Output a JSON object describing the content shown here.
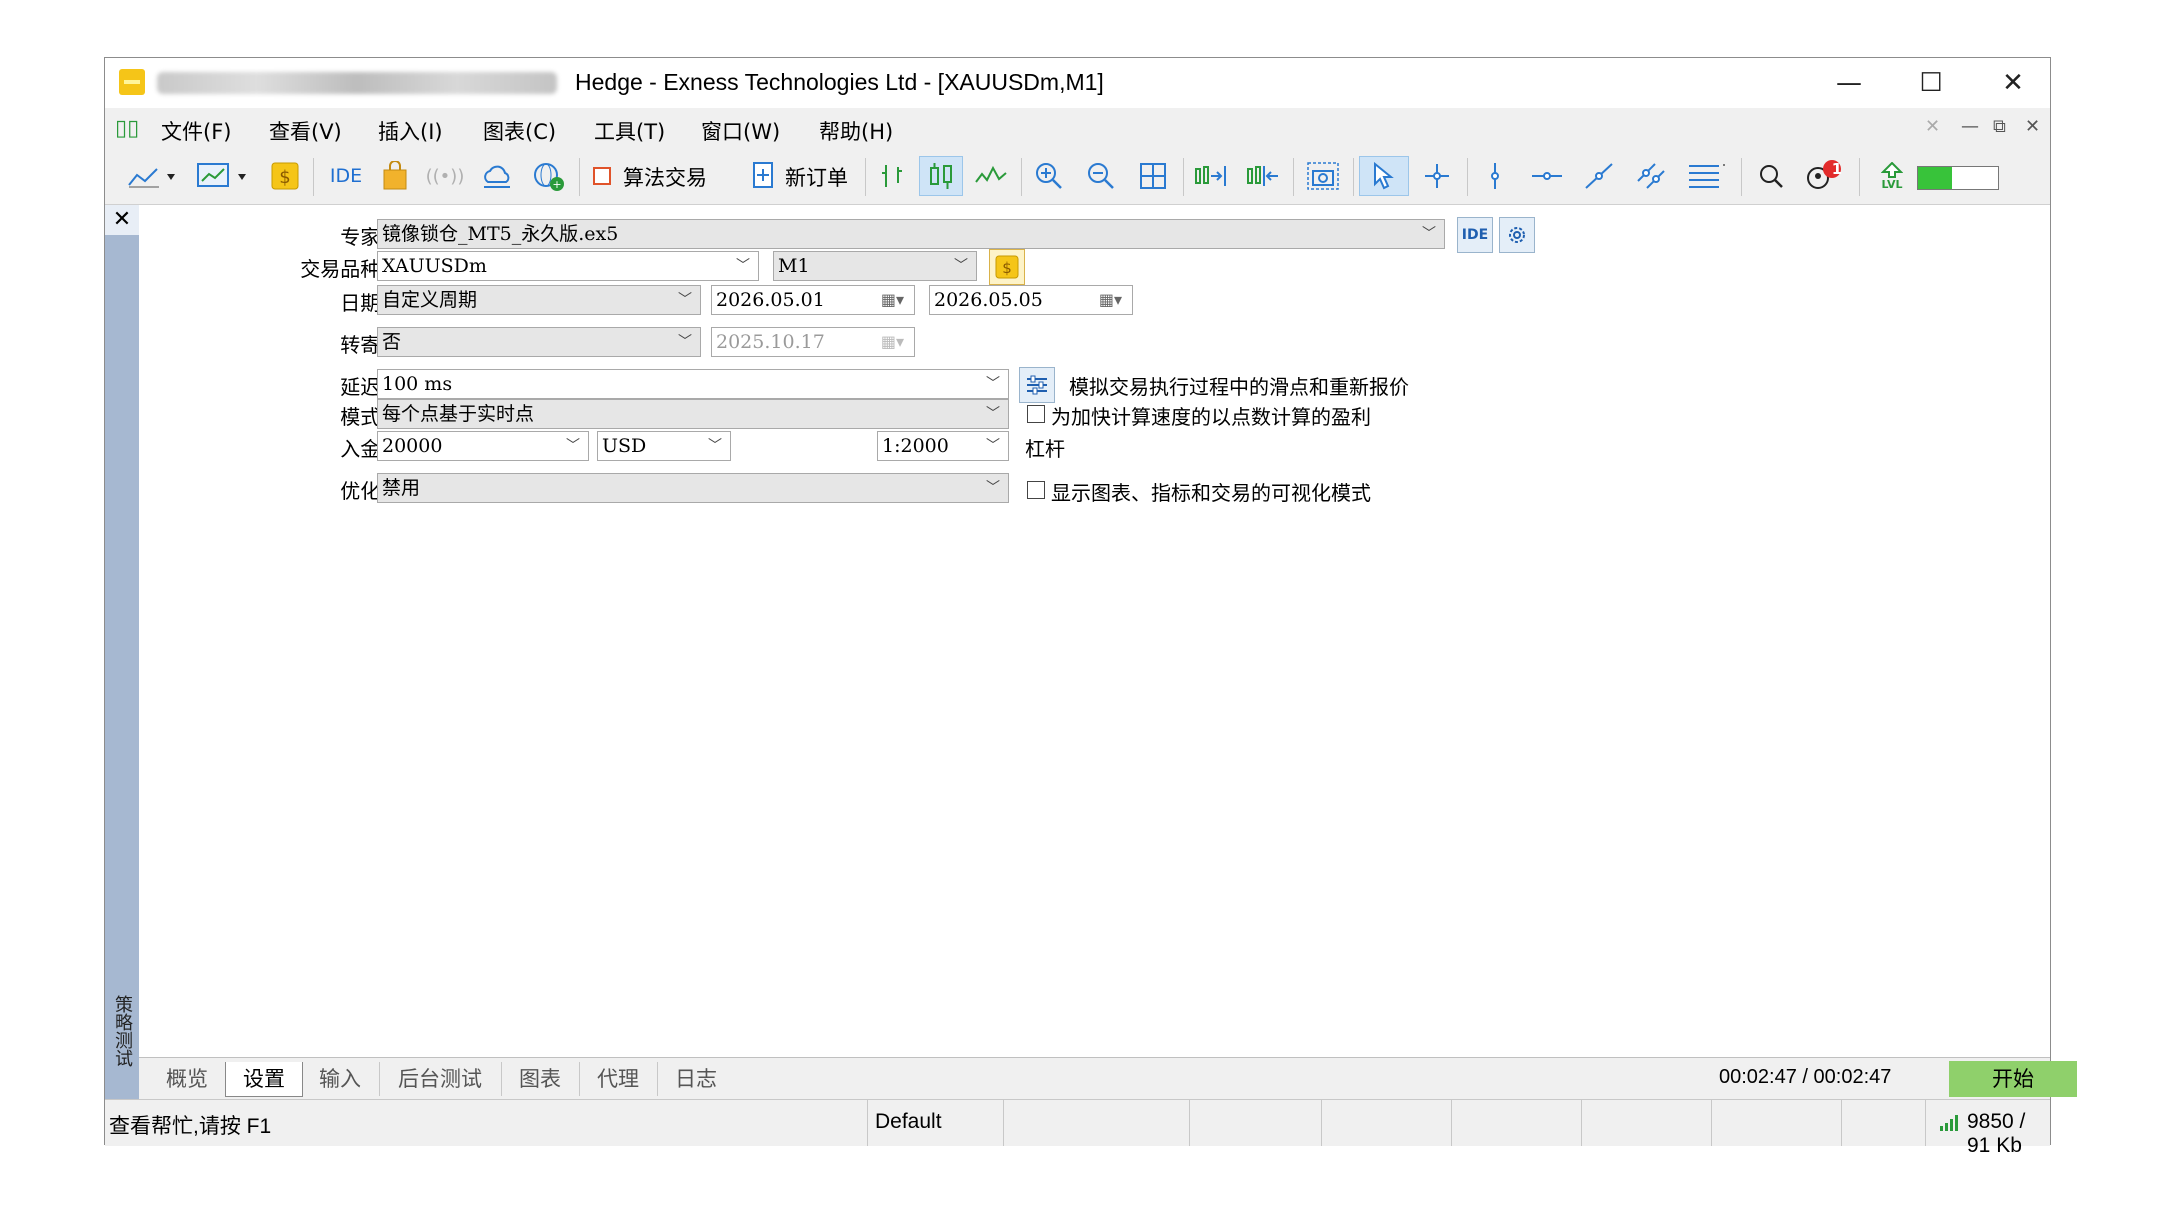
{
  "window": {
    "title": "Hedge - Exness Technologies Ltd - [XAUUSDm,M1]",
    "minimize_glyph": "—",
    "maximize_glyph": "☐",
    "close_glyph": "✕"
  },
  "menu": {
    "items": [
      "文件(F)",
      "查看(V)",
      "插入(I)",
      "图表(C)",
      "工具(T)",
      "窗口(W)",
      "帮助(H)"
    ],
    "doc_controls": [
      "✕",
      "—",
      "⧉",
      "✕"
    ]
  },
  "toolbar": {
    "ide_label": "IDE",
    "algo_trading_label": "算法交易",
    "new_order_label": "新订单",
    "notification_count": "1",
    "level_label": "LVL"
  },
  "sidebar": {
    "close_glyph": "✕",
    "vertical_label": "策略测试"
  },
  "form": {
    "expert_label": "专家:",
    "expert_value": "镜像锁仓_MT5_永久版.ex5",
    "ide_button": "IDE",
    "symbol_label": "交易品种:",
    "symbol_value": "XAUUSDm",
    "timeframe_value": "M1",
    "date_label": "日期:",
    "date_mode_value": "自定义周期",
    "date_from": "2026.05.01",
    "date_to": "2026.05.05",
    "forward_label": "转寄:",
    "forward_value": "否",
    "forward_date": "2025.10.17",
    "delay_label": "延迟:",
    "delay_value": "100 ms",
    "delay_note": "模拟交易执行过程中的滑点和重新报价",
    "model_label": "模式:",
    "model_value": "每个点基于实时点",
    "model_checkbox": "为加快计算速度的以点数计算的盈利",
    "deposit_label": "入金:",
    "deposit_value": "20000",
    "currency_value": "USD",
    "leverage_value": "1:2000",
    "leverage_label": "杠杆",
    "optimization_label": "优化:",
    "optimization_value": "禁用",
    "visual_checkbox": "显示图表、指标和交易的可视化模式"
  },
  "tabs": {
    "items": [
      "概览",
      "设置",
      "输入",
      "后台测试",
      "图表",
      "代理",
      "日志"
    ],
    "active": "设置",
    "timer": "00:02:47 / 00:02:47",
    "start_button": "开始"
  },
  "statusbar": {
    "help_text": "查看帮忙,请按 F1",
    "profile": "Default",
    "traffic": "9850 / 91 Kb"
  },
  "colors": {
    "arrow": "#1a9af0",
    "start_button": "#8fd06b",
    "sidebar": "#a6b8d1"
  }
}
